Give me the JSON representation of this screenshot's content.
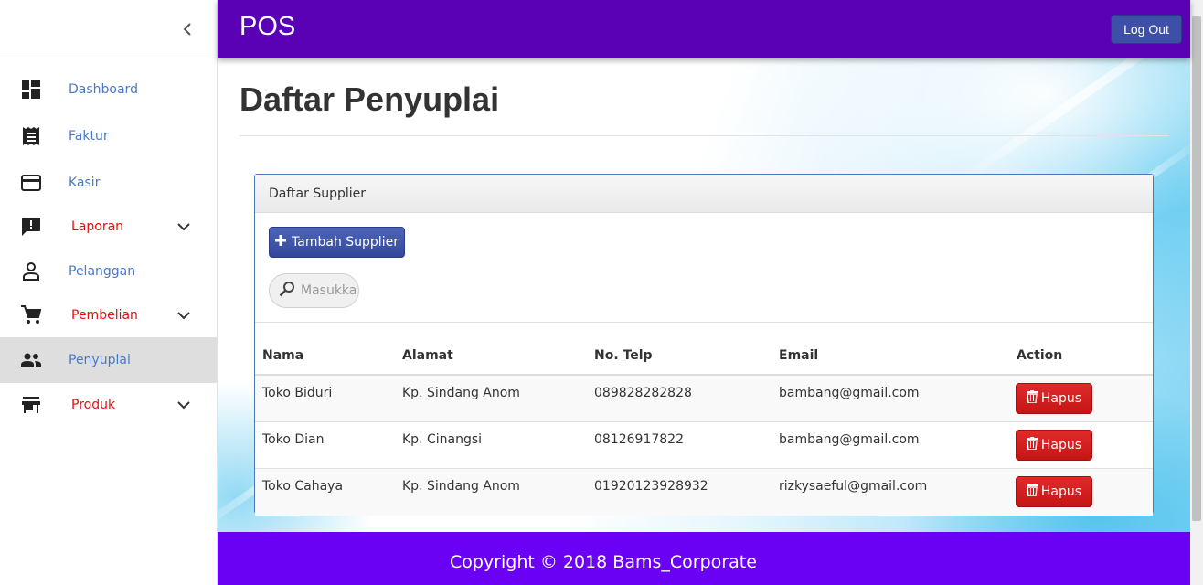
{
  "app": {
    "brand": "POS",
    "logout_label": "Log Out"
  },
  "sidebar": {
    "collapse_icon": "chevron-left-icon",
    "items": [
      {
        "label": "Dashboard",
        "icon": "dashboard-icon",
        "expandable": false,
        "active": false
      },
      {
        "label": "Faktur",
        "icon": "receipt-icon",
        "expandable": false,
        "active": false
      },
      {
        "label": "Kasir",
        "icon": "credit-card-icon",
        "expandable": false,
        "active": false
      },
      {
        "label": "Laporan",
        "icon": "report-icon",
        "expandable": true,
        "active": false
      },
      {
        "label": "Pelanggan",
        "icon": "person-icon",
        "expandable": false,
        "active": false
      },
      {
        "label": "Pembelian",
        "icon": "cart-icon",
        "expandable": true,
        "active": false
      },
      {
        "label": "Penyuplai",
        "icon": "people-icon",
        "expandable": false,
        "active": true
      },
      {
        "label": "Produk",
        "icon": "store-icon",
        "expandable": true,
        "active": false
      }
    ]
  },
  "main": {
    "page_title": "Daftar Penyuplai",
    "panel": {
      "title": "Daftar Supplier",
      "add_button_label": "Tambah Supplier",
      "search_placeholder": "Masukkan",
      "columns": [
        "Nama",
        "Alamat",
        "No. Telp",
        "Email",
        "Action"
      ],
      "rows": [
        {
          "nama": "Toko Biduri",
          "alamat": "Kp. Sindang Anom",
          "telp": "089828282828",
          "email": "bambang@gmail.com",
          "action": "Hapus"
        },
        {
          "nama": "Toko Dian",
          "alamat": "Kp. Cinangsi",
          "telp": "08126917822",
          "email": "bambang@gmail.com",
          "action": "Hapus"
        },
        {
          "nama": "Toko Cahaya",
          "alamat": "Kp. Sindang Anom",
          "telp": "01920123928932",
          "email": "rizkysaeful@gmail.com",
          "action": "Hapus"
        }
      ]
    }
  },
  "footer": {
    "text": "Copyright © 2018 Bams_Corporate"
  },
  "colors": {
    "header": "#5a00b5",
    "footer": "#6a00f4",
    "primary_button": "#3e4fa8",
    "danger_button": "#d11f1f",
    "link_blue": "#4a78c8",
    "link_red": "#e01010"
  }
}
